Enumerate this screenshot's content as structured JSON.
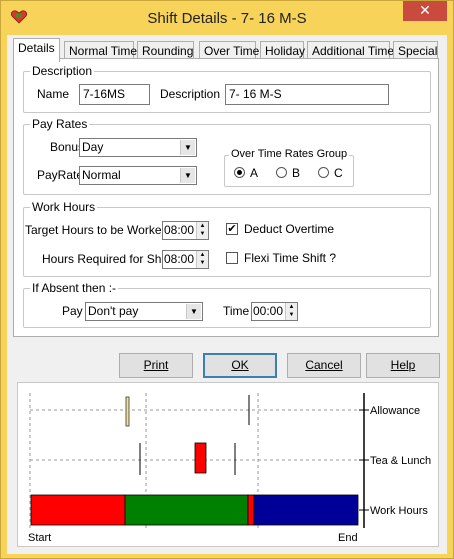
{
  "window": {
    "title": "Shift Details - 7- 16 M-S",
    "close_glyph": "✕",
    "accent": "#f7d35a"
  },
  "tabs": [
    {
      "label": "Details",
      "active": true
    },
    {
      "label": "Normal Time"
    },
    {
      "label": "Rounding"
    },
    {
      "label": "Over Time"
    },
    {
      "label": "Holiday"
    },
    {
      "label": "Additional Time"
    },
    {
      "label": "Special"
    }
  ],
  "description": {
    "group_title": "Description",
    "name_label": "Name",
    "name_value": "7-16MS",
    "desc_label": "Description",
    "desc_value": "7- 16 M-S"
  },
  "pay_rates": {
    "group_title": "Pay Rates",
    "bonus_label": "Bonus",
    "bonus_value": "Day",
    "payrate_label": "PayRate",
    "payrate_value": "Normal",
    "ot_group_title": "Over Time Rates Group",
    "options": [
      "A",
      "B",
      "C"
    ],
    "selected": "A"
  },
  "work_hours": {
    "group_title": "Work Hours",
    "target_label": "Target Hours to be Worked",
    "target_value": "08:00",
    "required_label": "Hours Required for Shift",
    "required_value": "08:00",
    "deduct_label": "Deduct Overtime",
    "deduct_checked": true,
    "flexi_label": "Flexi Time Shift ?",
    "flexi_checked": false
  },
  "absent": {
    "group_title": "If Absent then :-",
    "pay_label": "Pay",
    "pay_value": "Don't pay",
    "time_label": "Time",
    "time_value": "00:00"
  },
  "buttons": {
    "print": "Print",
    "ok": "OK",
    "cancel": "Cancel",
    "help": "Help"
  },
  "chart_data": {
    "type": "timeline",
    "rows": [
      "Allowance",
      "Tea & Lunch",
      "Work Hours"
    ],
    "x_start_label": "Start",
    "x_end_label": "End",
    "colors": {
      "red": "#ff0000",
      "green": "#008000",
      "blue": "#000099",
      "allowance": "#f2e394"
    }
  }
}
